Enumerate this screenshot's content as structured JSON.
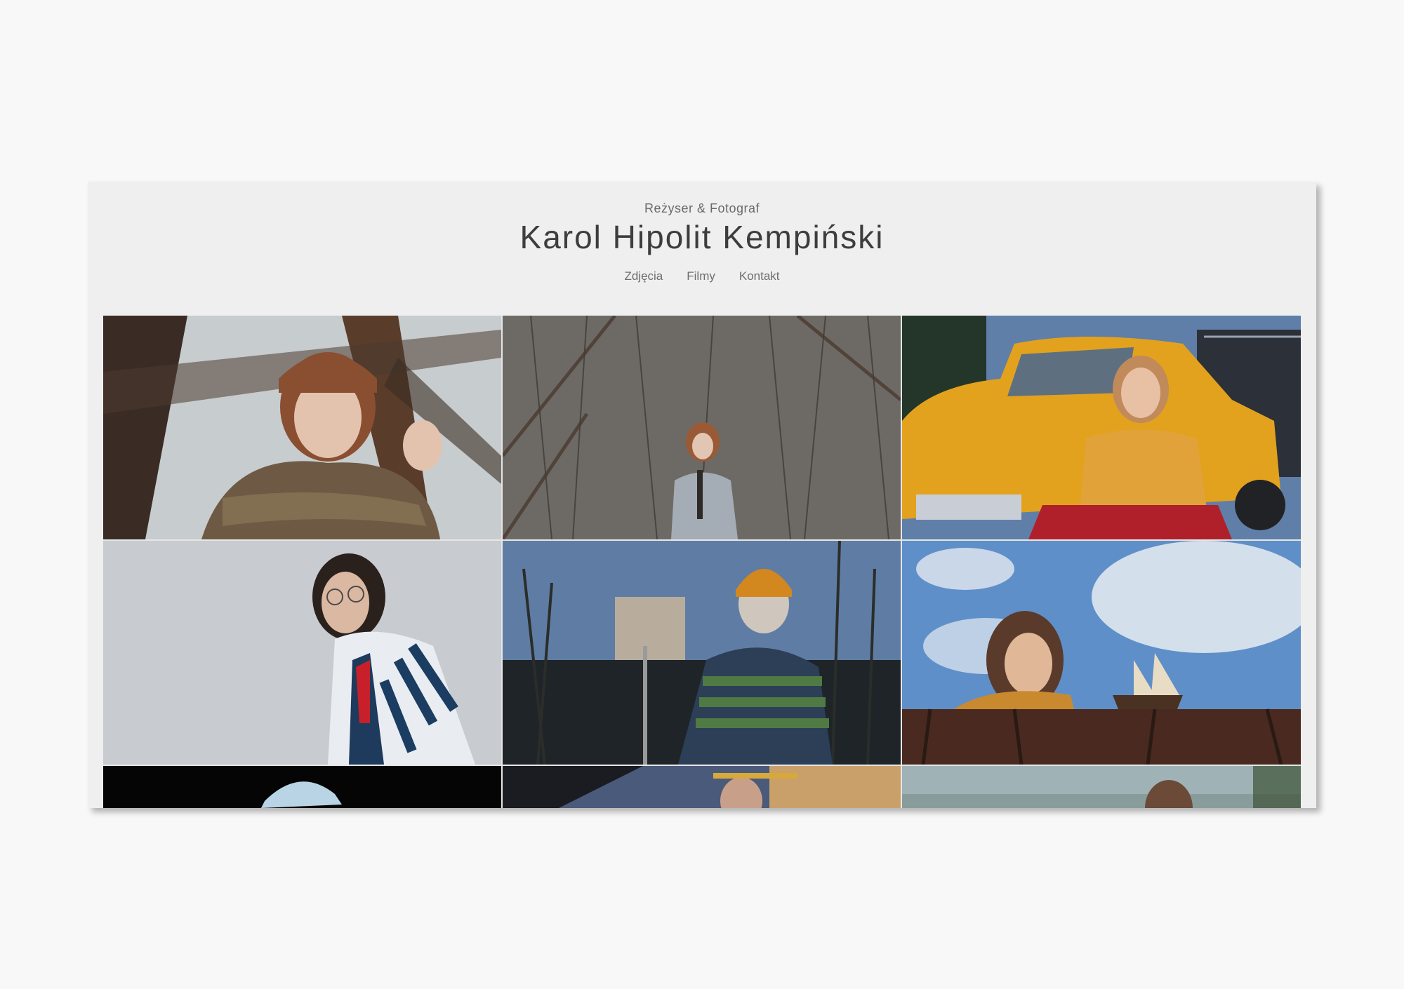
{
  "site": {
    "subtitle": "Reżyser & Fotograf",
    "title": "Karol Hipolit Kempiński"
  },
  "nav": {
    "items": [
      {
        "label": "Zdjęcia"
      },
      {
        "label": "Filmy"
      },
      {
        "label": "Kontakt"
      }
    ]
  },
  "gallery": {
    "photos": [
      {
        "name": "photo-girl-in-tree",
        "colors": {
          "bg": "#4a4038",
          "accent": "#8b5a3c"
        }
      },
      {
        "name": "photo-girl-by-wall",
        "colors": {
          "bg": "#6f6c68",
          "accent": "#9aa3ad"
        }
      },
      {
        "name": "photo-woman-yellow-car",
        "colors": {
          "bg": "#3a4050",
          "accent": "#e0a21d"
        }
      },
      {
        "name": "photo-person-glasses-jacket",
        "colors": {
          "bg": "#c9ccd0",
          "accent": "#1f3550"
        }
      },
      {
        "name": "photo-person-basketball-hoop",
        "colors": {
          "bg": "#5a7596",
          "accent": "#d2861f"
        }
      },
      {
        "name": "photo-woman-ship-model",
        "colors": {
          "bg": "#6a8fc0",
          "accent": "#c98a2f"
        }
      },
      {
        "name": "photo-person-cap-dark",
        "colors": {
          "bg": "#050505",
          "accent": "#b9d4e4"
        }
      },
      {
        "name": "photo-man-sunglasses",
        "colors": {
          "bg": "#4a5a7a",
          "accent": "#d7a83b"
        }
      },
      {
        "name": "photo-woman-landscape",
        "colors": {
          "bg": "#9fb2b6",
          "accent": "#6b4a38"
        }
      }
    ]
  }
}
